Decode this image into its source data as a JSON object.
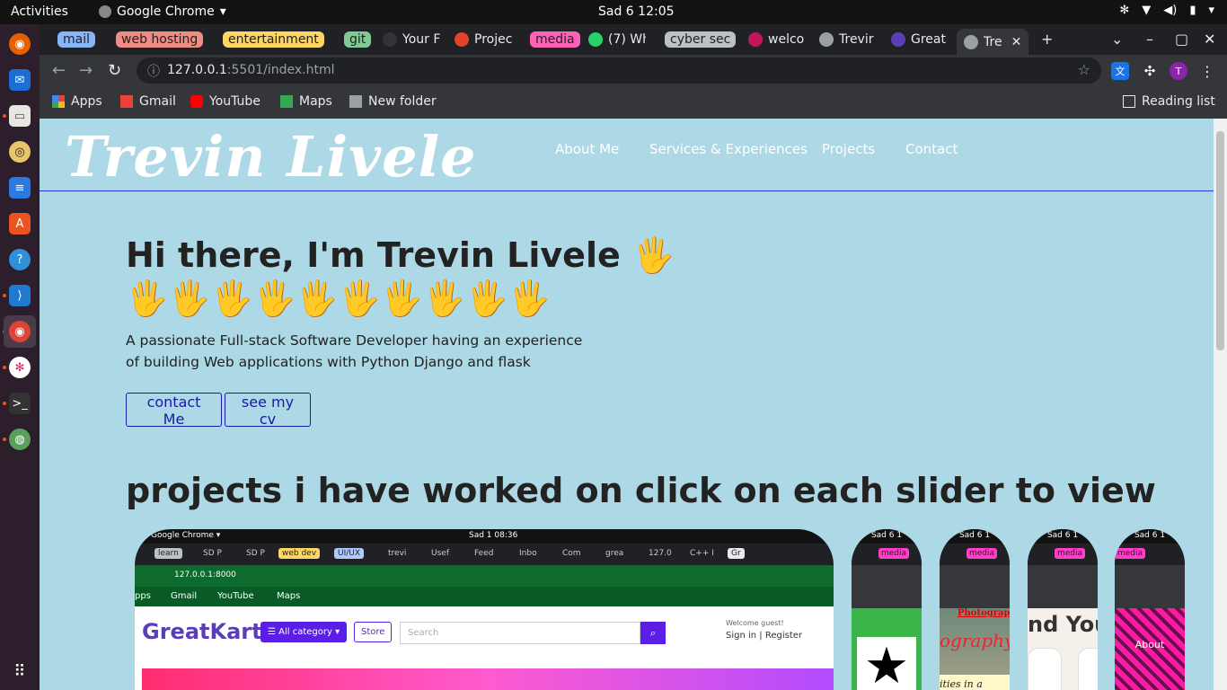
{
  "system": {
    "activities": "Activities",
    "app_menu": "Google Chrome",
    "clock": "Sad 6  12:05"
  },
  "browser": {
    "tabs": [
      {
        "label": "mail",
        "group_color": "#8ab4f8"
      },
      {
        "label": "web hosting",
        "group_color": "#f28b82"
      },
      {
        "label": "entertainment",
        "group_color": "#fdd663"
      },
      {
        "label": "git",
        "group_color": "#81c995"
      },
      {
        "label": "Your F"
      },
      {
        "label": "Projec"
      },
      {
        "label": "media",
        "group_color": "#ff63b8"
      },
      {
        "label": "(7) Wh"
      },
      {
        "label": "cyber sec",
        "group_color": "#bdc1c6"
      },
      {
        "label": "welco"
      },
      {
        "label": "Trevir"
      },
      {
        "label": "Great"
      },
      {
        "label": "Tre"
      }
    ],
    "url_host": "127.0.0.1",
    "url_rest": ":5501/index.html",
    "bookmarks": [
      "Apps",
      "Gmail",
      "YouTube",
      "Maps",
      "New folder"
    ],
    "reading_list": "Reading list",
    "profile_initial": "T"
  },
  "site": {
    "logo": "Trevin Livele",
    "nav": [
      "About Me",
      "Services & Experiences",
      "Projects",
      "Contact"
    ],
    "hero_title": "Hi there, I'm Trevin Livele 🖐",
    "hero_hands": "🖐🖐🖐🖐🖐🖐🖐🖐🖐🖐",
    "hero_desc": "A passionate Full-stack Software Developer having an experience of building Web applications with Python Django and flask",
    "btn_contact": "contact Me",
    "btn_cv": "see my cv",
    "projects_heading": "projects i have worked on click on each slider to view"
  },
  "slides": {
    "main": {
      "sys_app": "Google Chrome ▾",
      "sys_clock": "Sad 1  08:36",
      "chips": [
        "learn",
        "SD P",
        "SD P",
        "web dev",
        "UI/UX",
        "trevi",
        "Usef",
        "Feed",
        "Inbo",
        "Com",
        "grea",
        "127.0",
        "C++ I",
        "Gr"
      ],
      "url": "127.0.0.1:8000",
      "bookmarks": [
        "pps",
        "Gmail",
        "YouTube",
        "Maps"
      ],
      "logo": "GreatKart",
      "category_btn": "☰ All category ▾",
      "store_btn": "Store",
      "search_placeholder": "Search",
      "welcome": "Welcome guest!",
      "signin": "Sign in | Register"
    },
    "small": [
      {
        "clock": "Sad 6  1",
        "media": "media",
        "text": "★",
        "bg": "#3bb54a"
      },
      {
        "clock": "Sad 6  1",
        "media": "media",
        "text": "Photography",
        "bg": "#8a9a8a"
      },
      {
        "clock": "Sad 6  1",
        "media": "media",
        "text": "nd You",
        "bg": "#f5f0ea"
      },
      {
        "clock": "Sad 6  1",
        "media": "media",
        "text": "About",
        "bg": "#e0188f"
      }
    ]
  }
}
